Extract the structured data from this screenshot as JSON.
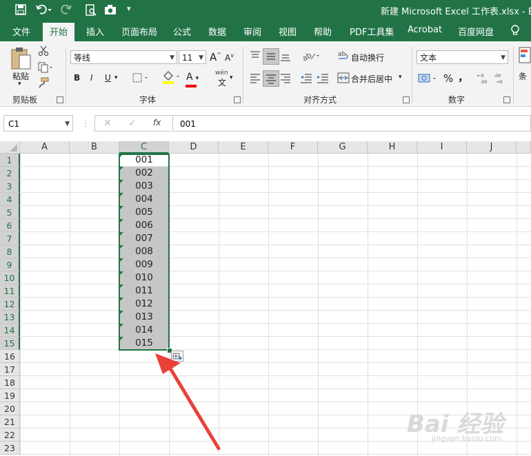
{
  "window": {
    "title": "新建 Microsoft Excel 工作表.xlsx  -  Exc"
  },
  "tabs": [
    "文件",
    "开始",
    "插入",
    "页面布局",
    "公式",
    "数据",
    "审阅",
    "视图",
    "帮助",
    "PDF工具集",
    "Acrobat",
    "百度网盘"
  ],
  "ribbon": {
    "clipboard": {
      "paste": "粘贴",
      "label": "剪贴板"
    },
    "font": {
      "name": "等线",
      "size": "11",
      "grow": "A",
      "shrink": "A",
      "bold": "B",
      "italic": "I",
      "underline": "U",
      "color_a": "A",
      "wen": "wén",
      "wen2": "文",
      "label": "字体"
    },
    "alignment": {
      "wrap": "自动换行",
      "merge": "合并后居中",
      "label": "对齐方式"
    },
    "number": {
      "format": "文本",
      "percent": "%",
      "comma": "，",
      "label": "数字"
    },
    "cond": "条"
  },
  "formula_bar": {
    "name_box": "C1",
    "fx": "fx",
    "value": "001"
  },
  "sheet": {
    "columns": [
      "A",
      "B",
      "C",
      "D",
      "E",
      "F",
      "G",
      "H",
      "I",
      "J"
    ],
    "rows": [
      "1",
      "2",
      "3",
      "4",
      "5",
      "6",
      "7",
      "8",
      "9",
      "10",
      "11",
      "12",
      "13",
      "14",
      "15",
      "16",
      "17",
      "18",
      "19",
      "20",
      "21",
      "22",
      "23"
    ],
    "colC": [
      "001",
      "002",
      "003",
      "004",
      "005",
      "006",
      "007",
      "008",
      "009",
      "010",
      "011",
      "012",
      "013",
      "014",
      "015"
    ]
  },
  "watermark": {
    "text": "Bai 经验",
    "sub": "jingyan.baidu.com"
  },
  "colors": {
    "excel_green": "#217346",
    "arrow": "#e8413a",
    "selection_shade": "#c6c6c6"
  }
}
